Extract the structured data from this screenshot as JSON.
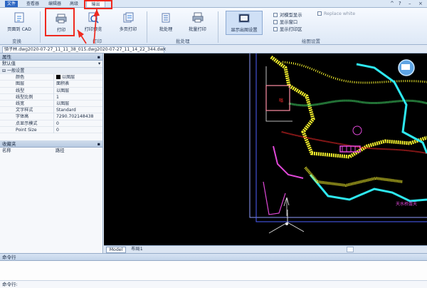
{
  "menu": {
    "items": [
      "文件",
      "查看器",
      "编辑器",
      "高级",
      "输出"
    ],
    "active": "输出"
  },
  "ribbon": {
    "group_conversion": "变换",
    "group_print": "打印",
    "group_batch": "批处理",
    "group_display": "绘图设置",
    "buttons": {
      "page_to_cad": "页面到 CAD",
      "print": "打印",
      "print_preview": "打印预览",
      "multi_print": "多页打印",
      "batch_process": "批处理",
      "batch_print": "批量打印",
      "show_print_settings": "显示出图设置"
    },
    "checkboxes": {
      "model_display": "对模型显示",
      "show_window": "显示窗口",
      "show_print_area": "显示打印区",
      "replace_white": "Replace white"
    }
  },
  "document_tab": "骑子林.dwg2020-07-27_11_11_38_015.dwg2020-07-27_11_14_22_344.dwf",
  "properties": {
    "title": "属性",
    "default_label": "默认值",
    "section": "一般设置",
    "rows": [
      {
        "key": "颜色",
        "value": "以图层"
      },
      {
        "key": "图层",
        "value": "面积表"
      },
      {
        "key": "线型",
        "value": "以图层"
      },
      {
        "key": "线型比例",
        "value": "1"
      },
      {
        "key": "线宽",
        "value": "以图层"
      },
      {
        "key": "文字样式",
        "value": "Standard"
      },
      {
        "key": "字体高",
        "value": "7290.702148438"
      },
      {
        "key": "点显示模式",
        "value": "0"
      },
      {
        "key": "Point Size",
        "value": "0"
      }
    ]
  },
  "favorites": {
    "title": "收藏夹",
    "col_name": "名称",
    "col_path": "路径"
  },
  "canvas_tabs": {
    "model": "Model",
    "layout": "布局1"
  },
  "canvas_text": {
    "right_label": "天水桥露天",
    "red_box_label": "嗡"
  },
  "command": {
    "title": "命令行",
    "prompt": "命令行:"
  },
  "colors": {
    "accent_red": "#ef2a1f",
    "ribbon_bg": "#e7eef8",
    "cad_bg": "#000000",
    "cad_yellow": "#f6f22d",
    "cad_cyan": "#2ee8f0",
    "cad_red": "#ff2c2c",
    "cad_magenta": "#e048d8",
    "cad_green": "#45e26b"
  }
}
